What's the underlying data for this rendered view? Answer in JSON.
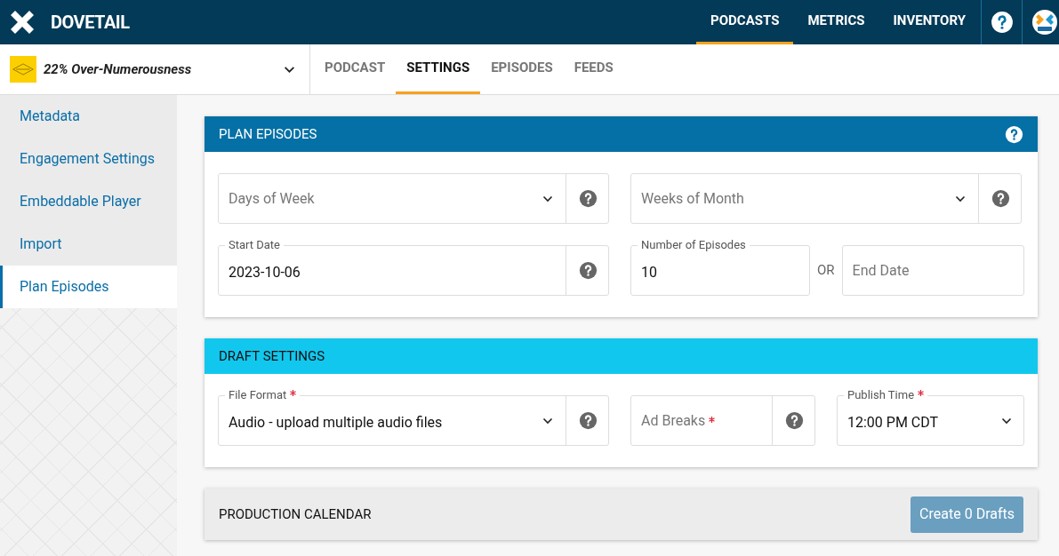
{
  "brand": {
    "name": "DOVETAIL"
  },
  "top_nav": [
    {
      "label": "PODCASTS",
      "selected": true
    },
    {
      "label": "METRICS",
      "selected": false
    },
    {
      "label": "INVENTORY",
      "selected": false
    }
  ],
  "podcast_selector": {
    "title": "22% Over-Numerousness"
  },
  "tabs": [
    {
      "label": "PODCAST",
      "selected": false
    },
    {
      "label": "SETTINGS",
      "selected": true
    },
    {
      "label": "EPISODES",
      "selected": false
    },
    {
      "label": "FEEDS",
      "selected": false
    }
  ],
  "sidebar": {
    "items": [
      {
        "label": "Metadata",
        "selected": false
      },
      {
        "label": "Engagement Settings",
        "selected": false
      },
      {
        "label": "Embeddable Player",
        "selected": false
      },
      {
        "label": "Import",
        "selected": false
      },
      {
        "label": "Plan Episodes",
        "selected": true
      }
    ]
  },
  "cards": [
    {
      "title": "PLAN EPISODES",
      "help": true,
      "rows": [
        [
          {
            "kind": "select",
            "placeholder": "Days of Week",
            "help": true
          },
          {
            "kind": "select",
            "placeholder": "Weeks of Month",
            "help": true
          }
        ],
        [
          {
            "kind": "input",
            "label": "Start Date",
            "value": "2023-10-06",
            "help": true
          },
          {
            "kind": "input",
            "label": "Number of Episodes",
            "value": "10"
          },
          {
            "kind": "separator",
            "text": "OR"
          },
          {
            "kind": "input",
            "placeholder": "End Date"
          }
        ]
      ]
    },
    {
      "title": "DRAFT SETTINGS",
      "rows": [
        [
          {
            "kind": "select",
            "label": "File Format",
            "required": true,
            "value": "Audio - upload multiple audio files",
            "help": true
          },
          {
            "kind": "input",
            "placeholder": "Ad Breaks",
            "required": true,
            "help": true
          },
          {
            "kind": "select",
            "label": "Publish Time",
            "required": true,
            "value": "12:00 PM CDT"
          }
        ]
      ]
    },
    {
      "title": "PRODUCTION CALENDAR",
      "action": "Create 0 Drafts"
    }
  ]
}
